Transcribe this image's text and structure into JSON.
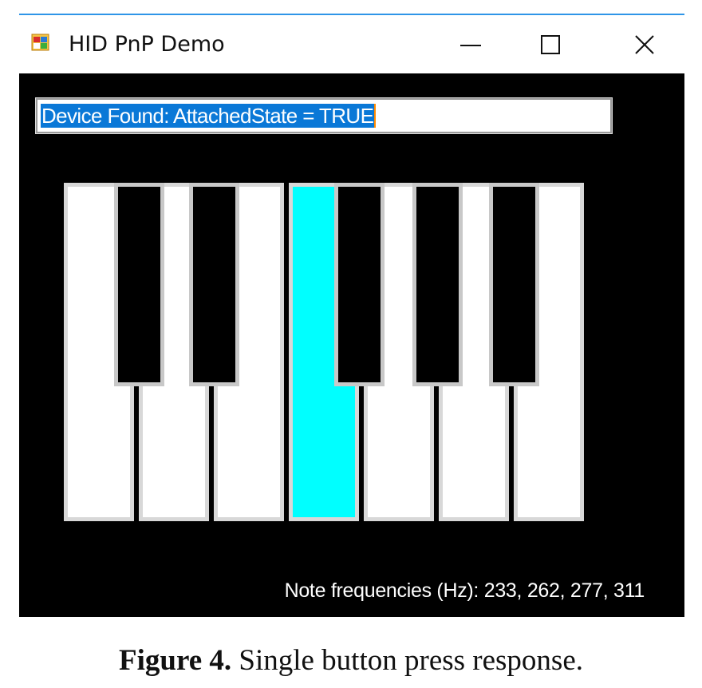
{
  "window": {
    "title": "HID PnP Demo",
    "accent_color": "#2f95e8",
    "app_icon": "windows-forms-app-icon",
    "controls": {
      "minimize_icon": "minimize-icon",
      "maximize_icon": "maximize-icon",
      "close_icon": "close-icon"
    }
  },
  "status": {
    "text": "Device Found: AttachedState = TRUE",
    "selection_color": "#0a78d7"
  },
  "keyboard": {
    "white_key_count": 7,
    "black_key_count": 5,
    "pressed_white_key_index": 3,
    "pressed_color": "#00ffff"
  },
  "footer": {
    "note_frequencies": "Note frequencies (Hz): 233, 262, 277, 311"
  },
  "caption": {
    "label": "Figure 4.",
    "text": " Single button press response."
  }
}
